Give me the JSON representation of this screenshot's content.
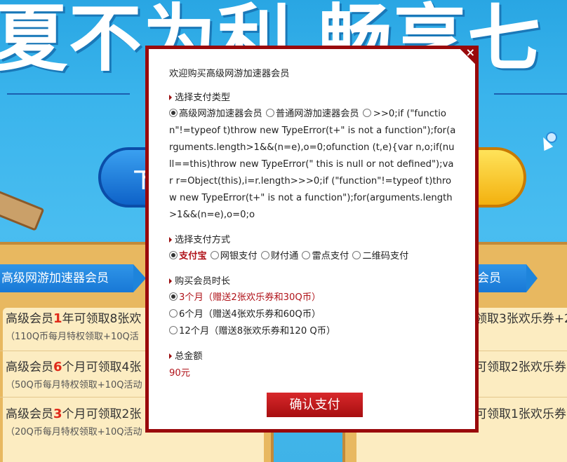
{
  "background": {
    "banner_text": "夏不为利 畅享七",
    "button_left_text": "下",
    "ribbon_left": "高级网游加速器会员",
    "ribbon_right": "会员",
    "offers_left": [
      {
        "prefix": "高级会员",
        "num": "1",
        "suffix": "年可领取8张欢",
        "sub": "（110Q币每月特权领取+10Q活"
      },
      {
        "prefix": "高级会员",
        "num": "6",
        "suffix": "个月可领取4张",
        "sub": "（50Q币每月特权领取+10Q活动"
      },
      {
        "prefix": "高级会员",
        "num": "3",
        "suffix": "个月可领取2张",
        "sub": "（20Q币每月特权领取+10Q活动"
      }
    ],
    "offers_right": [
      {
        "main": "领取3张欢乐券+2"
      },
      {
        "main": "可领取2张欢乐券+"
      },
      {
        "main": "可领取1张欢乐券+"
      }
    ]
  },
  "modal": {
    "welcome": "欢迎购买高级网游加速器会员",
    "pay_type": {
      "title": "选择支付类型",
      "options": [
        "高级网游加速器会员",
        "普通网游加速器会员"
      ],
      "raw_text": ">>0;if (\"function\"!=typeof t)throw new TypeError(t+\" is not a function\");for(arguments.length>1&&(n=e),o=0;ofunction (t,e){var n,o;if(null==this)throw new TypeError(\" this is null or not defined\");var r=Object(this),i=r.length>>>0;if (\"function\"!=typeof t)throw new TypeError(t+\" is not a function\");for(arguments.length>1&&(n=e),o=0;o"
    },
    "pay_method": {
      "title": "选择支付方式",
      "options": [
        "支付宝",
        "网银支付",
        "财付通",
        "雷点支付",
        "二维码支付"
      ]
    },
    "duration": {
      "title": "购买会员时长",
      "options": [
        "3个月（赠送2张欢乐券和30Q币）",
        "6个月（赠送4张欢乐券和60Q币）",
        "12个月（赠送8张欢乐券和120 Q币）"
      ]
    },
    "total": {
      "title": "总金额",
      "value": "90元"
    },
    "confirm_label": "确认支付",
    "close_label": "×"
  }
}
